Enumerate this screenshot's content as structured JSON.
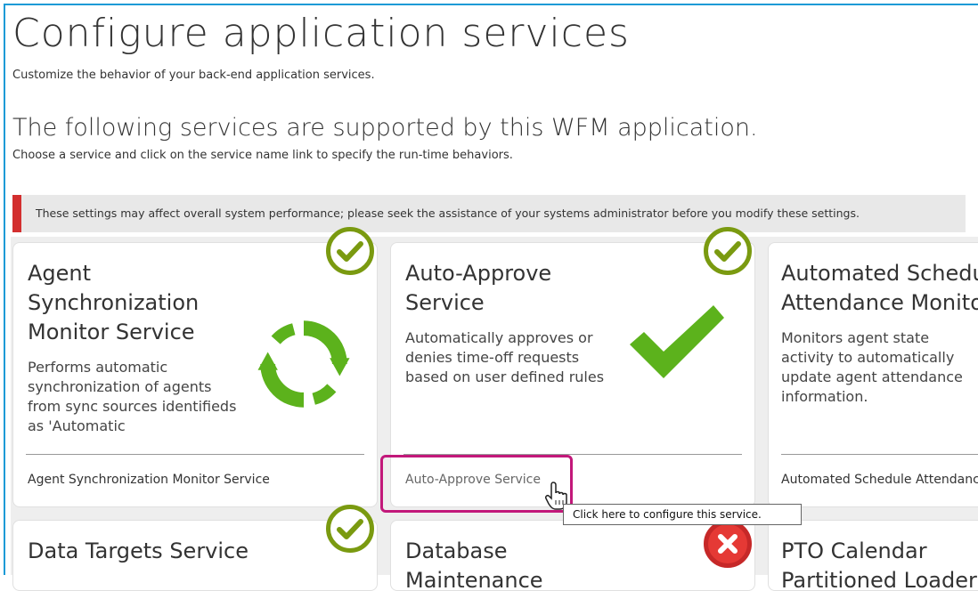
{
  "page": {
    "title": "Configure application services",
    "subtitle": "Customize the behavior of your back-end application services.",
    "section_title": "The following services are supported by this WFM application.",
    "section_subtitle": "Choose a service and click on the service name link to specify the run-time behaviors."
  },
  "warning": {
    "text": "These settings may affect overall system performance; please seek the assistance of your systems administrator before you modify these settings.",
    "accent_color": "#d32f2f"
  },
  "cards": [
    {
      "title_lines": [
        "Agent",
        "Synchronization",
        "Monitor Service"
      ],
      "description": "Performs automatic synchronization of agents from sync sources identifieds as 'Automatic",
      "footer_link": "Agent Synchronization Monitor Service",
      "status": "enabled",
      "icon": "sync-icon"
    },
    {
      "title_lines": [
        "Auto-Approve",
        "Service"
      ],
      "description": "Automatically approves or denies time-off requests based on user defined rules",
      "footer_link": "Auto-Approve Service",
      "status": "enabled",
      "icon": "checkmark-icon"
    },
    {
      "title_lines": [
        "Automated Schedule",
        "Attendance Monitor"
      ],
      "description": "Monitors agent state activity to automatically update agent attendance information.",
      "footer_link": "Automated Schedule Attendance",
      "status": "unknown"
    },
    {
      "title_lines": [
        "Data Targets Service"
      ],
      "status": "enabled"
    },
    {
      "title_lines": [
        "Database",
        "Maintenance"
      ],
      "status": "disabled"
    },
    {
      "title_lines": [
        "PTO Calendar",
        "Partitioned Loader"
      ],
      "status": "unknown"
    }
  ],
  "tooltip": {
    "text": "Click here to configure this service."
  },
  "colors": {
    "enabled_badge": "#7a9a10",
    "icon_green": "#5cb21c",
    "disabled_badge": "#e53935",
    "highlight": "#c2187a",
    "frame": "#1a9ad6"
  }
}
